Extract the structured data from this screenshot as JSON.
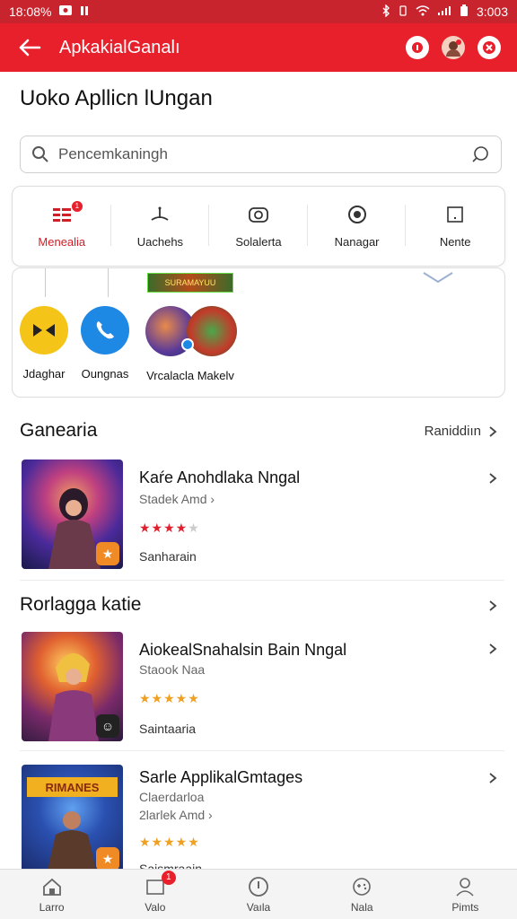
{
  "statusbar": {
    "time_left": "18:08%",
    "time_right": "3:003"
  },
  "appbar": {
    "title": "ApkakialGanalı"
  },
  "page": {
    "title": "Uoko Apllicn lUngan"
  },
  "search": {
    "placeholder": "Pencemkaningh"
  },
  "categories": [
    {
      "label": "Menealia",
      "icon": "grid-icon",
      "active": true,
      "badge": "1"
    },
    {
      "label": "Uachehs",
      "icon": "antenna-icon"
    },
    {
      "label": "Solalerta",
      "icon": "camera-icon"
    },
    {
      "label": "Nanagar",
      "icon": "eye-icon"
    },
    {
      "label": "Nente",
      "icon": "square-icon"
    }
  ],
  "apps": {
    "banner": "SURAMAYUU",
    "items": [
      {
        "label": "Jdaghar",
        "icon": "bowtie-icon"
      },
      {
        "label": "Oungnas",
        "icon": "phone-icon"
      },
      {
        "label": "Vrcalacla Makelv",
        "icon": "game-avatar-icon"
      }
    ]
  },
  "section1": {
    "title": "Ganearia",
    "link": "Raniddiın",
    "game": {
      "title": "Kaŕe Anohdlaka Nngal",
      "sub": "Stadek Amd",
      "stars": "★★★★",
      "stars_empty": "★",
      "status": "Sanharain",
      "star_color": "#e0202e"
    }
  },
  "section2": {
    "title": "Rorlagga katie",
    "game1": {
      "title": "AiokealSnahalsin Bain Nngal",
      "sub": "Staook Naa",
      "stars": "★★★★★",
      "status": "Saintaaria",
      "star_color": "#f0a020"
    },
    "game2": {
      "title": "Sarle ApplikalGmtages",
      "sub1": "Claerdarloa",
      "sub2": "2larlek Amd",
      "stars": "★★★★★",
      "status": "Saismraain",
      "star_color": "#f0a020",
      "thumb_text": "RIMANES"
    }
  },
  "bottomnav": [
    {
      "label": "Larro",
      "icon": "home-icon"
    },
    {
      "label": "Valo",
      "icon": "window-icon",
      "badge": "1"
    },
    {
      "label": "Vaıla",
      "icon": "compass-icon"
    },
    {
      "label": "Nala",
      "icon": "controller-icon"
    },
    {
      "label": "Pimts",
      "icon": "profile-icon"
    }
  ]
}
